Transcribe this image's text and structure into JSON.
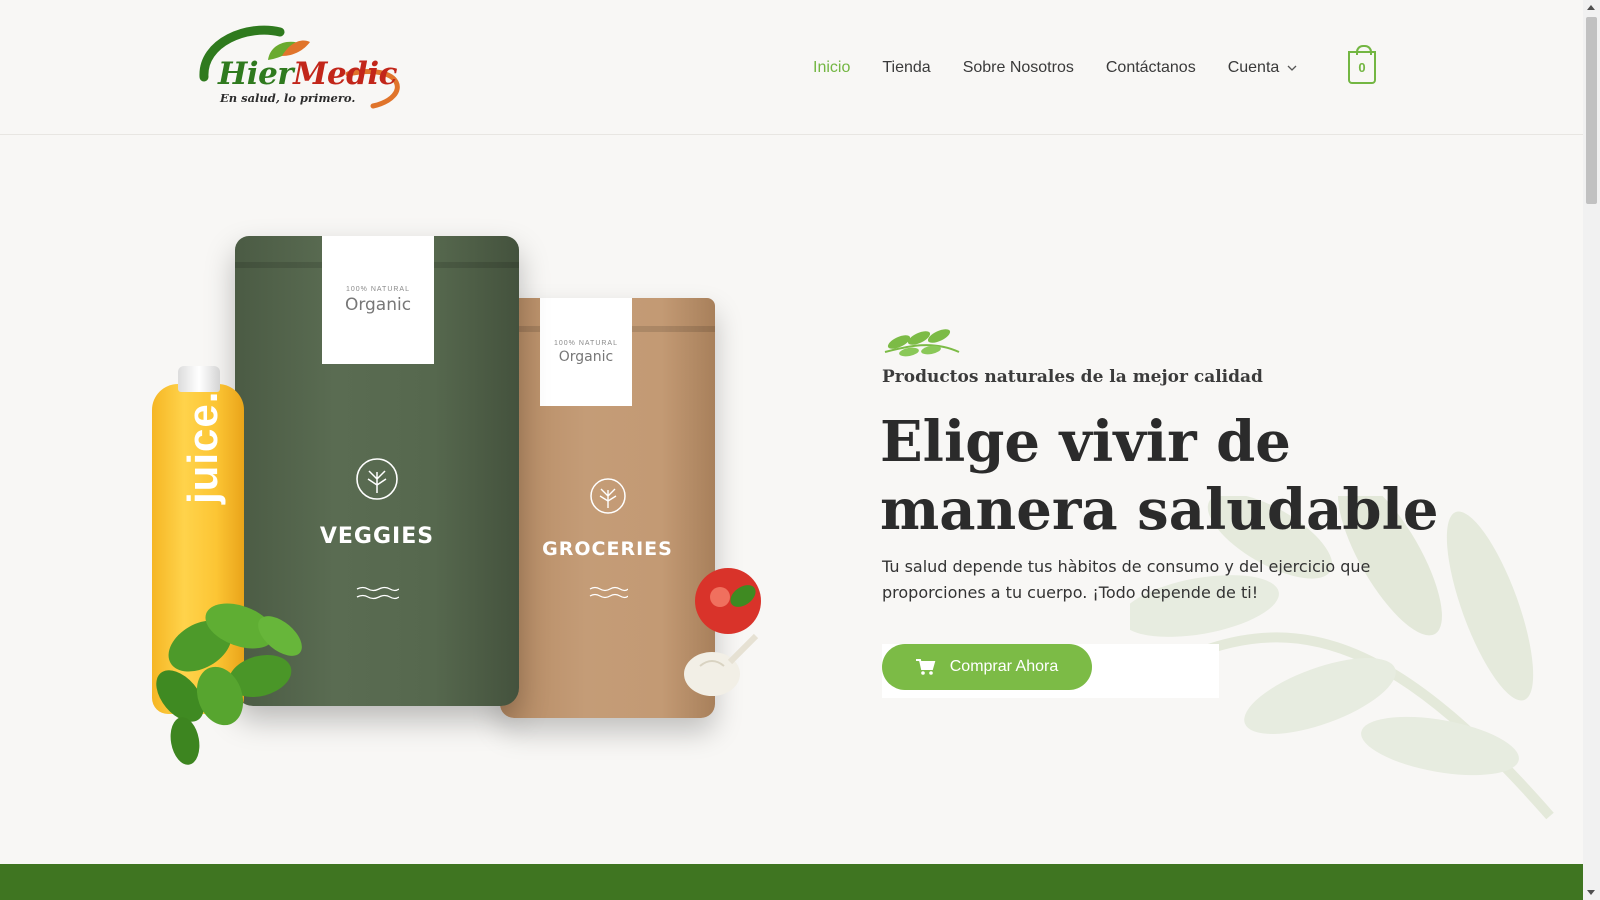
{
  "brand": {
    "name_part1": "Hier",
    "name_part2": "Medic",
    "tagline": "En salud, lo primero.",
    "colors": {
      "green": "#2f7a1e",
      "red": "#c2261a",
      "orange": "#e0742b"
    }
  },
  "nav": {
    "items": [
      {
        "label": "Inicio",
        "active": true
      },
      {
        "label": "Tienda",
        "active": false
      },
      {
        "label": "Sobre Nosotros",
        "active": false
      },
      {
        "label": "Contáctanos",
        "active": false
      },
      {
        "label": "Cuenta",
        "active": false,
        "has_dropdown": true
      }
    ],
    "cart_count": "0",
    "accent_color": "#73b642"
  },
  "hero": {
    "product_image": {
      "bag_green": {
        "label_top": "100% NATURAL",
        "label": "Organic",
        "title": "VEGGIES"
      },
      "bag_kraft": {
        "label_top": "100% NATURAL",
        "label": "Organic",
        "title": "GROCERIES"
      },
      "bottle_text": "juice."
    },
    "subtitle": "Productos naturales de la mejor calidad",
    "headline": "Elige vivir de manera saludable",
    "description": "Tu salud depende tus hàbitos de consumo y del ejercicio que proporciones a tu cuerpo. ¡Todo depende de ti!",
    "cta_label": "Comprar Ahora",
    "cta_color": "#7cbb46"
  },
  "band_color": "#3f7521"
}
